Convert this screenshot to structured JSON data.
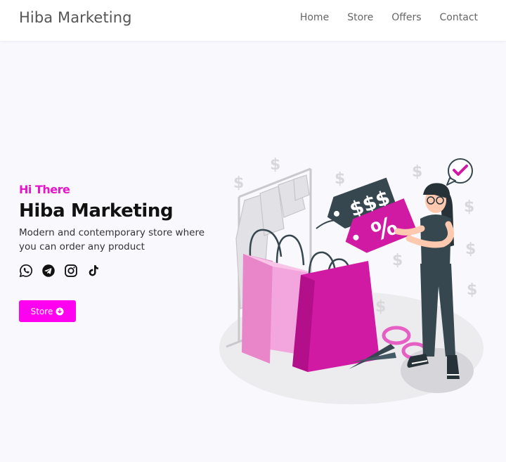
{
  "navbar": {
    "brand": "Hiba Marketing",
    "links": [
      "Home",
      "Store",
      "Offers",
      "Contact"
    ]
  },
  "hero": {
    "greeting": "Hi There",
    "title": "Hiba Marketing",
    "description": "Modern and contemporary store where you can order any product",
    "button_label": "Store"
  },
  "socials": {
    "icons": [
      "whatsapp-icon",
      "telegram-icon",
      "instagram-icon",
      "tiktok-icon"
    ]
  },
  "illustration": {
    "tag_dollars": "$$$",
    "tag_percent": "%",
    "floating_symbol": "$"
  },
  "colors": {
    "accent": "#ff00f0",
    "greeting": "#e617c9",
    "bag_light": "#f3a6de",
    "bag_dark": "#d11aa3",
    "tag_dark": "#37474f"
  }
}
